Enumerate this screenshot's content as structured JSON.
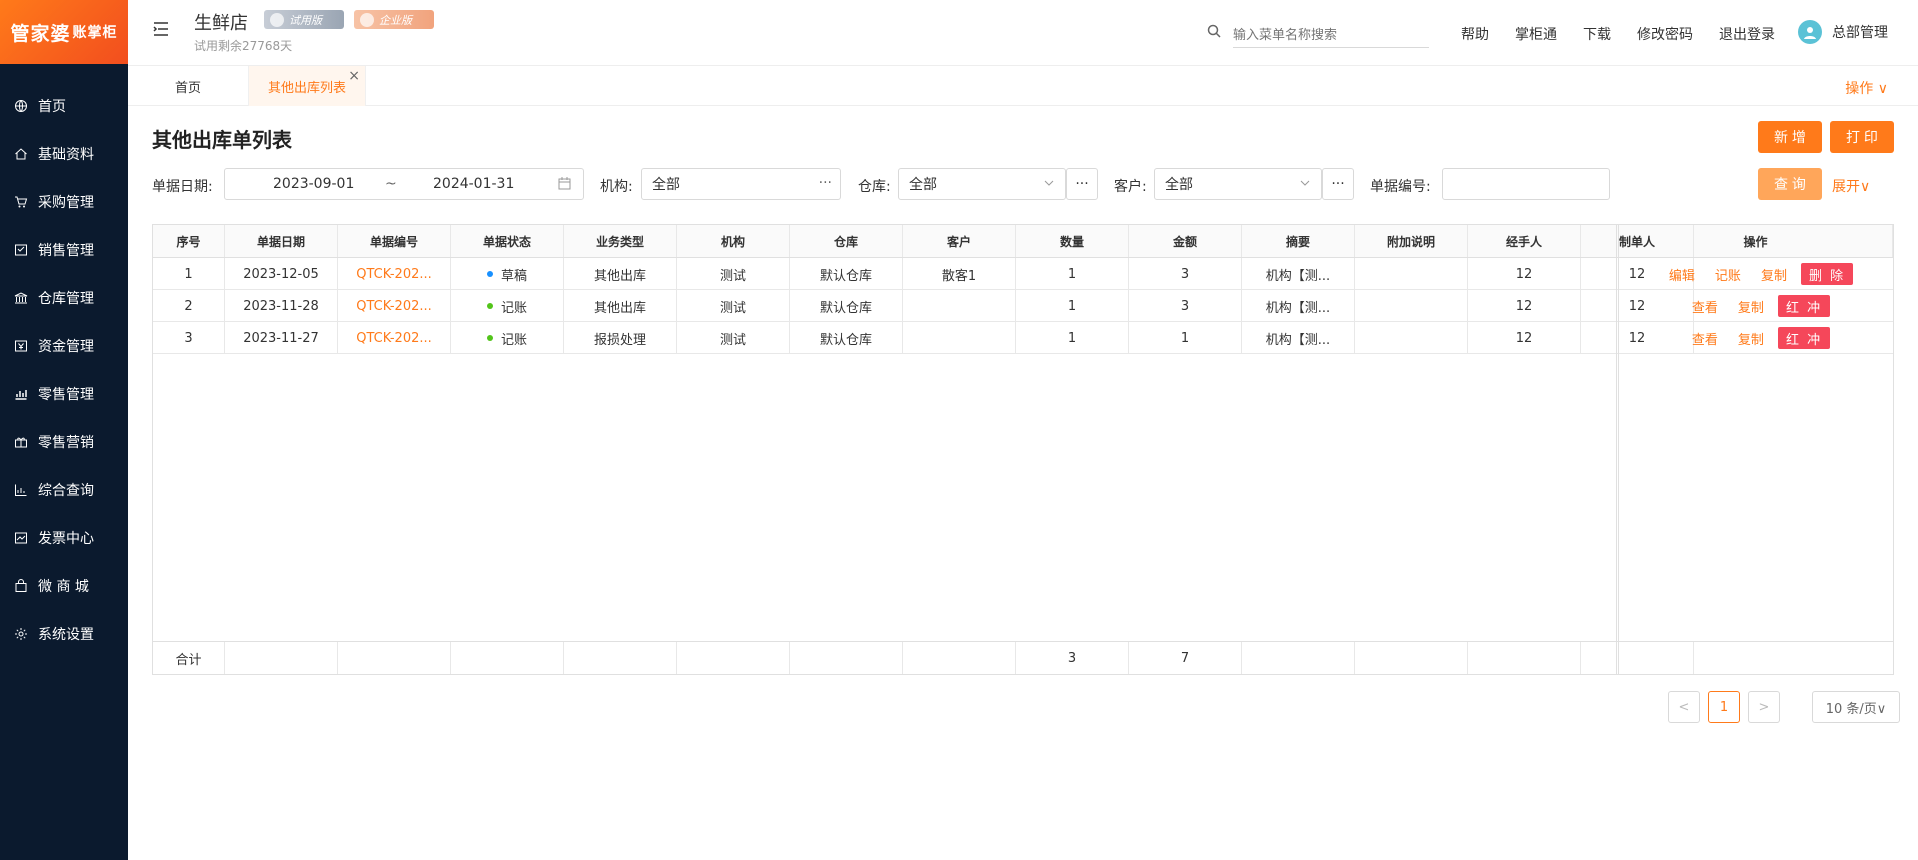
{
  "logo": {
    "main": "管家婆",
    "sub": "账掌柜"
  },
  "sidebar": {
    "items": [
      {
        "label": "首页",
        "icon": "globe-icon"
      },
      {
        "label": "基础资料",
        "icon": "home-icon"
      },
      {
        "label": "采购管理",
        "icon": "cart-icon"
      },
      {
        "label": "销售管理",
        "icon": "receipt-icon"
      },
      {
        "label": "仓库管理",
        "icon": "bank-icon"
      },
      {
        "label": "资金管理",
        "icon": "money-icon"
      },
      {
        "label": "零售管理",
        "icon": "chart-icon"
      },
      {
        "label": "零售营销",
        "icon": "gift-icon"
      },
      {
        "label": "综合查询",
        "icon": "bar-chart-icon"
      },
      {
        "label": "发票中心",
        "icon": "invoice-icon"
      },
      {
        "label": "微 商 城",
        "icon": "bag-icon"
      },
      {
        "label": "系统设置",
        "icon": "gear-icon"
      }
    ],
    "active_index": 4
  },
  "header": {
    "store_name": "生鲜店",
    "badge_trial": "试用版",
    "badge_enterprise": "企业版",
    "trial_remaining": "试用剩余27768天",
    "search_placeholder": "输入菜单名称搜索",
    "links": [
      "帮助",
      "掌柜通",
      "下载",
      "修改密码",
      "退出登录"
    ],
    "user_name": "总部管理"
  },
  "tabs": {
    "home": "首页",
    "current": "其他出库列表",
    "close": "×",
    "ops": "操作 ∨"
  },
  "page": {
    "title": "其他出库单列表",
    "btn_add": "新 增",
    "btn_print": "打 印",
    "btn_query": "查 询",
    "expand": "展开∨"
  },
  "filters": {
    "date_label": "单据日期:",
    "date_from": "2023-09-01",
    "date_sep": "~",
    "date_to": "2024-01-31",
    "org_label": "机构:",
    "org_value": "全部",
    "warehouse_label": "仓库:",
    "warehouse_value": "全部",
    "customer_label": "客户:",
    "customer_value": "全部",
    "docno_label": "单据编号:",
    "docno_value": "",
    "dots": "···"
  },
  "table": {
    "columns": [
      "序号",
      "单据日期",
      "单据编号",
      "单据状态",
      "业务类型",
      "机构",
      "仓库",
      "客户",
      "数量",
      "金额",
      "摘要",
      "附加说明",
      "经手人",
      "制单人",
      "操作"
    ],
    "rows": [
      {
        "no": "1",
        "date": "2023-12-05",
        "code": "QTCK-202...",
        "status": "草稿",
        "status_color": "#1890ff",
        "type": "其他出库",
        "org": "测试",
        "warehouse": "默认仓库",
        "customer": "散客1",
        "qty": "1",
        "amount": "3",
        "summary": "机构【测...",
        "note": "",
        "handler": "12",
        "creator": "12",
        "actions": [
          "编辑",
          "记账",
          "复制"
        ],
        "action_btn": "删 除"
      },
      {
        "no": "2",
        "date": "2023-11-28",
        "code": "QTCK-202...",
        "status": "记账",
        "status_color": "#52c41a",
        "type": "其他出库",
        "org": "测试",
        "warehouse": "默认仓库",
        "customer": "",
        "qty": "1",
        "amount": "3",
        "summary": "机构【测...",
        "note": "",
        "handler": "12",
        "creator": "12",
        "actions": [
          "查看",
          "复制"
        ],
        "action_btn": "红 冲"
      },
      {
        "no": "3",
        "date": "2023-11-27",
        "code": "QTCK-202...",
        "status": "记账",
        "status_color": "#52c41a",
        "type": "报损处理",
        "org": "测试",
        "warehouse": "默认仓库",
        "customer": "",
        "qty": "1",
        "amount": "1",
        "summary": "机构【测...",
        "note": "",
        "handler": "12",
        "creator": "12",
        "actions": [
          "查看",
          "复制"
        ],
        "action_btn": "红 冲"
      }
    ],
    "footer": {
      "label": "合计",
      "qty": "3",
      "amount": "7"
    }
  },
  "pagination": {
    "prev": "<",
    "current": "1",
    "next": ">",
    "page_size": "10 条/页∨"
  },
  "colors": {
    "accent": "#ff7a1a",
    "danger": "#f5475a",
    "sidebar_bg": "#0b1a2e"
  }
}
